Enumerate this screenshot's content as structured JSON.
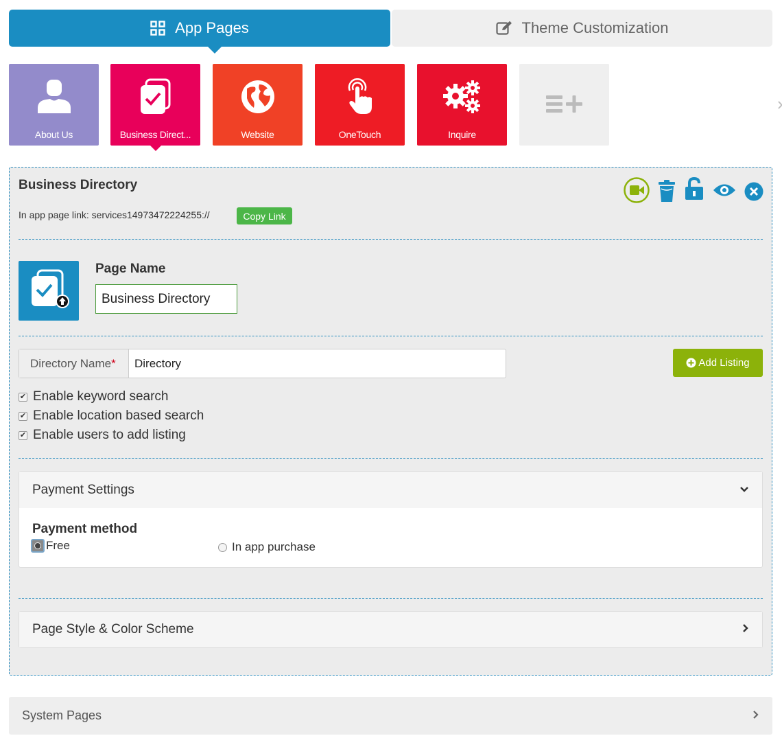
{
  "top_tabs": {
    "app_pages": "App Pages",
    "theme_customization": "Theme Customization"
  },
  "tiles": [
    {
      "label": "About Us",
      "color": "#938bcb",
      "icon": "person-icon"
    },
    {
      "label": "Business Direct...",
      "color": "#e8005a",
      "icon": "directory-icon"
    },
    {
      "label": "Website",
      "color": "#f04126",
      "icon": "globe-icon"
    },
    {
      "label": "OneTouch",
      "color": "#ee1c25",
      "icon": "touch-icon"
    },
    {
      "label": "Inquire",
      "color": "#e8112d",
      "icon": "gears-icon"
    },
    {
      "label": "",
      "color": "#efefef",
      "icon": "add-page-icon"
    }
  ],
  "panel": {
    "title": "Business Directory",
    "link_text": "In app page link: services14973472224255://",
    "copy_link": "Copy Link",
    "page_name_label": "Page Name",
    "page_name_value": "Business Directory",
    "directory_name_label": "Directory Name",
    "directory_name_required": "*",
    "directory_name_value": "Directory",
    "add_listing": "Add Listing",
    "checkboxes": [
      {
        "label": "Enable keyword search",
        "checked": true
      },
      {
        "label": "Enable location based search",
        "checked": true
      },
      {
        "label": "Enable users to add listing",
        "checked": true
      }
    ],
    "payment_settings": "Payment Settings",
    "payment_method": "Payment method",
    "payment_options": [
      "Free",
      "In app purchase"
    ],
    "page_style": "Page Style & Color Scheme"
  },
  "system_pages": "System Pages",
  "colors": {
    "primary_blue": "#1a8dc2",
    "green": "#4cb648",
    "lime": "#8cb20a"
  }
}
